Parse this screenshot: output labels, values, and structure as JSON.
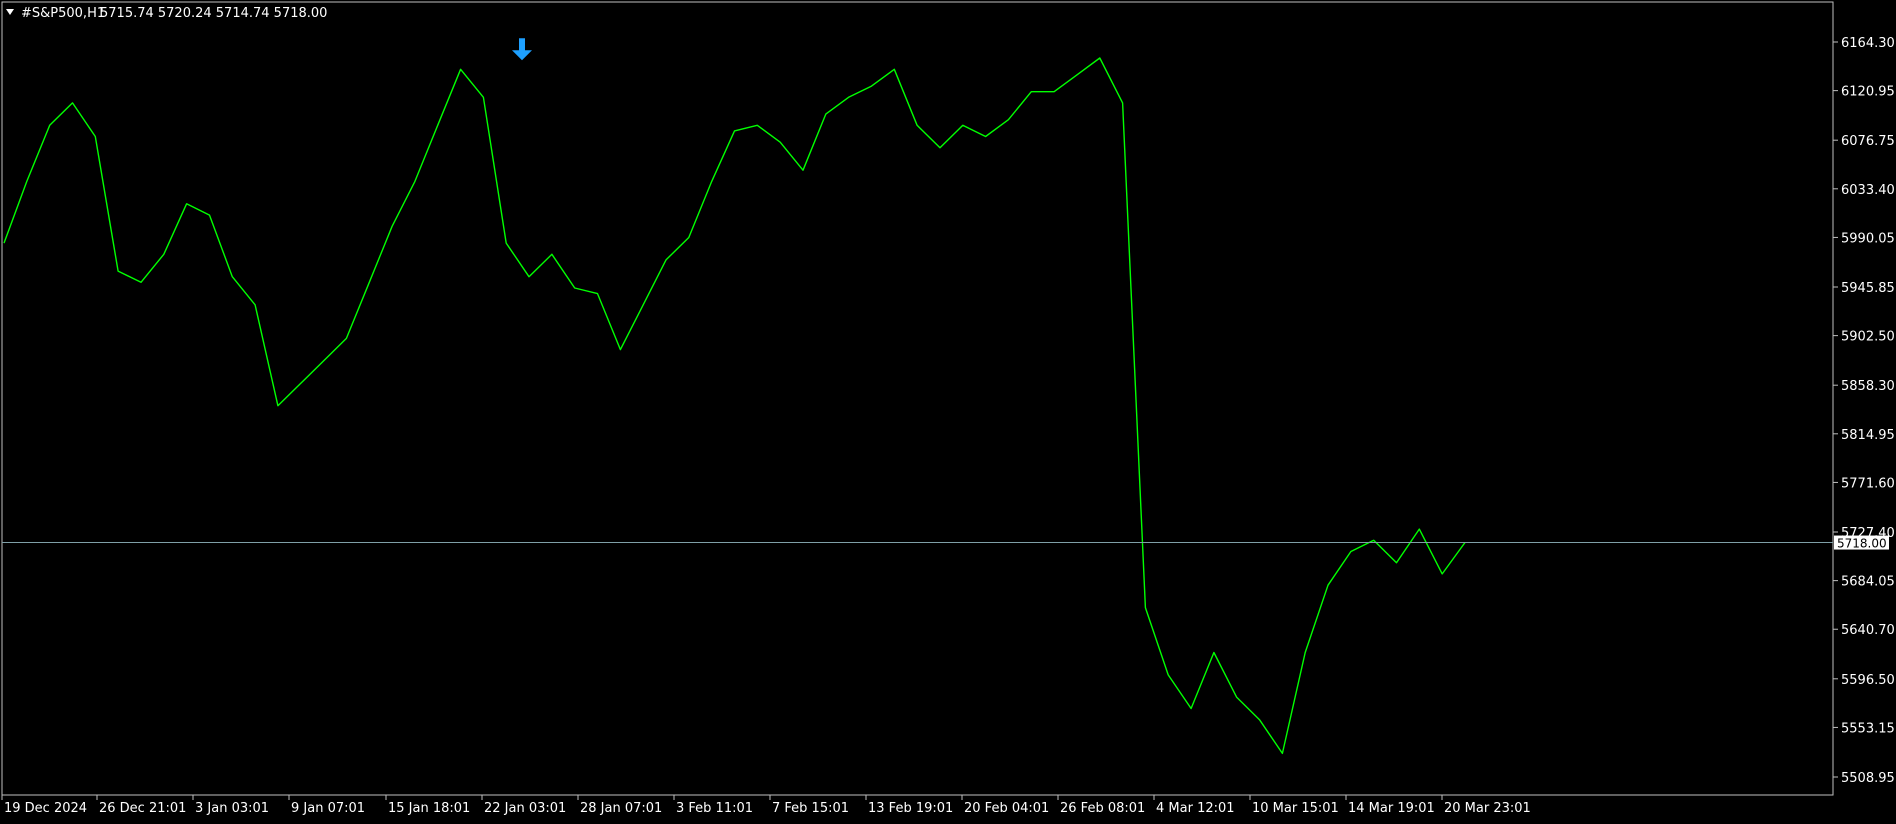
{
  "header": {
    "menu_arrow_icon": "triangle-down-icon",
    "symbol": "#S&P500,H1",
    "ohlc": "5715.74 5720.24 5714.74 5718.00"
  },
  "colors": {
    "background": "#000000",
    "price_line": "#00ff00",
    "bid_line": "#7f9fa7",
    "signal_arrow": "#1ea0ff",
    "axis_text": "#ffffff",
    "frame": "#bfbfbf"
  },
  "chart_data": {
    "type": "line",
    "timeframe": "H1",
    "symbol": "#S&P500",
    "x": [
      "19 Dec 2024",
      "26 Dec 21:01",
      "3 Jan 03:01",
      "9 Jan 07:01",
      "15 Jan 18:01",
      "22 Jan 03:01",
      "28 Jan 07:01",
      "3 Feb 11:01",
      "7 Feb 15:01",
      "13 Feb 19:01",
      "20 Feb 04:01",
      "26 Feb 08:01",
      "4 Mar 12:01",
      "10 Mar 15:01",
      "14 Mar 19:01",
      "20 Mar 23:01"
    ],
    "x_tick_labels": [
      "19 Dec 2024",
      "26 Dec 21:01",
      "3 Jan 03:01",
      "9 Jan 07:01",
      "15 Jan 18:01",
      "22 Jan 03:01",
      "28 Jan 07:01",
      "3 Feb 11:01",
      "7 Feb 15:01",
      "13 Feb 19:01",
      "20 Feb 04:01",
      "26 Feb 08:01",
      "4 Mar 12:01",
      "10 Mar 15:01",
      "14 Mar 19:01",
      "20 Mar 23:01"
    ],
    "y_tick_labels": [
      "6164.30",
      "6120.95",
      "6076.75",
      "6033.40",
      "5990.05",
      "5945.85",
      "5902.50",
      "5858.30",
      "5814.95",
      "5771.60",
      "5727.40",
      "5684.05",
      "5640.70",
      "5596.50",
      "5553.15",
      "5508.95"
    ],
    "ylim": [
      5495,
      6180
    ],
    "series": [
      {
        "values": [
          5985,
          6040,
          6090,
          6110,
          6080,
          5960,
          5950,
          5975,
          6020,
          6010,
          5955,
          5930,
          5840,
          5860,
          5880,
          5900,
          5950,
          6000,
          6040,
          6090,
          6140,
          6115,
          5985,
          5955,
          5975,
          5945,
          5940,
          5890,
          5930,
          5970,
          5990,
          6040,
          6085,
          6090,
          6075,
          6050,
          6100,
          6115,
          6125,
          6140,
          6090,
          6070,
          6090,
          6080,
          6095,
          6120,
          6120,
          6135,
          6150,
          6110,
          5660,
          5600,
          5570,
          5620,
          5580,
          5560,
          5530,
          5620,
          5680,
          5710,
          5720,
          5700,
          5730,
          5690,
          5718
        ]
      }
    ],
    "current_price": 5718.0,
    "bid_line_price": 5718.0,
    "signal": {
      "type": "sell-arrow",
      "x": "22 Jan 03:01",
      "price": 6148
    }
  }
}
